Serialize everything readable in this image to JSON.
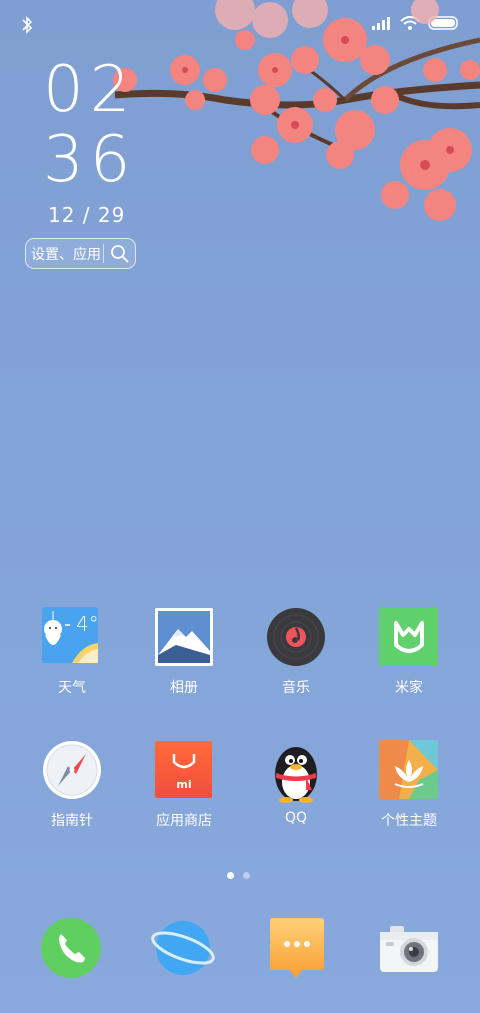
{
  "clock": {
    "hours": "02",
    "minutes": "36",
    "date": "12 / 29"
  },
  "search": {
    "text": "设置、应用"
  },
  "apps": [
    {
      "label": "天气",
      "icon": "weather-icon",
      "temp": "4°"
    },
    {
      "label": "相册",
      "icon": "gallery-icon"
    },
    {
      "label": "音乐",
      "icon": "music-icon"
    },
    {
      "label": "米家",
      "icon": "mijia-icon"
    },
    {
      "label": "指南针",
      "icon": "compass-icon"
    },
    {
      "label": "应用商店",
      "icon": "app-store-icon",
      "badge": "mi"
    },
    {
      "label": "QQ",
      "icon": "qq-icon"
    },
    {
      "label": "个性主题",
      "icon": "themes-icon"
    }
  ],
  "dock": [
    {
      "icon": "phone-icon"
    },
    {
      "icon": "browser-icon"
    },
    {
      "icon": "messages-icon"
    },
    {
      "icon": "camera-icon"
    }
  ],
  "pager": {
    "current": 1,
    "total": 2
  },
  "colors": {
    "background": "#83a4d7",
    "blossom": "#f47c7c",
    "branch": "#5a3a2a"
  }
}
